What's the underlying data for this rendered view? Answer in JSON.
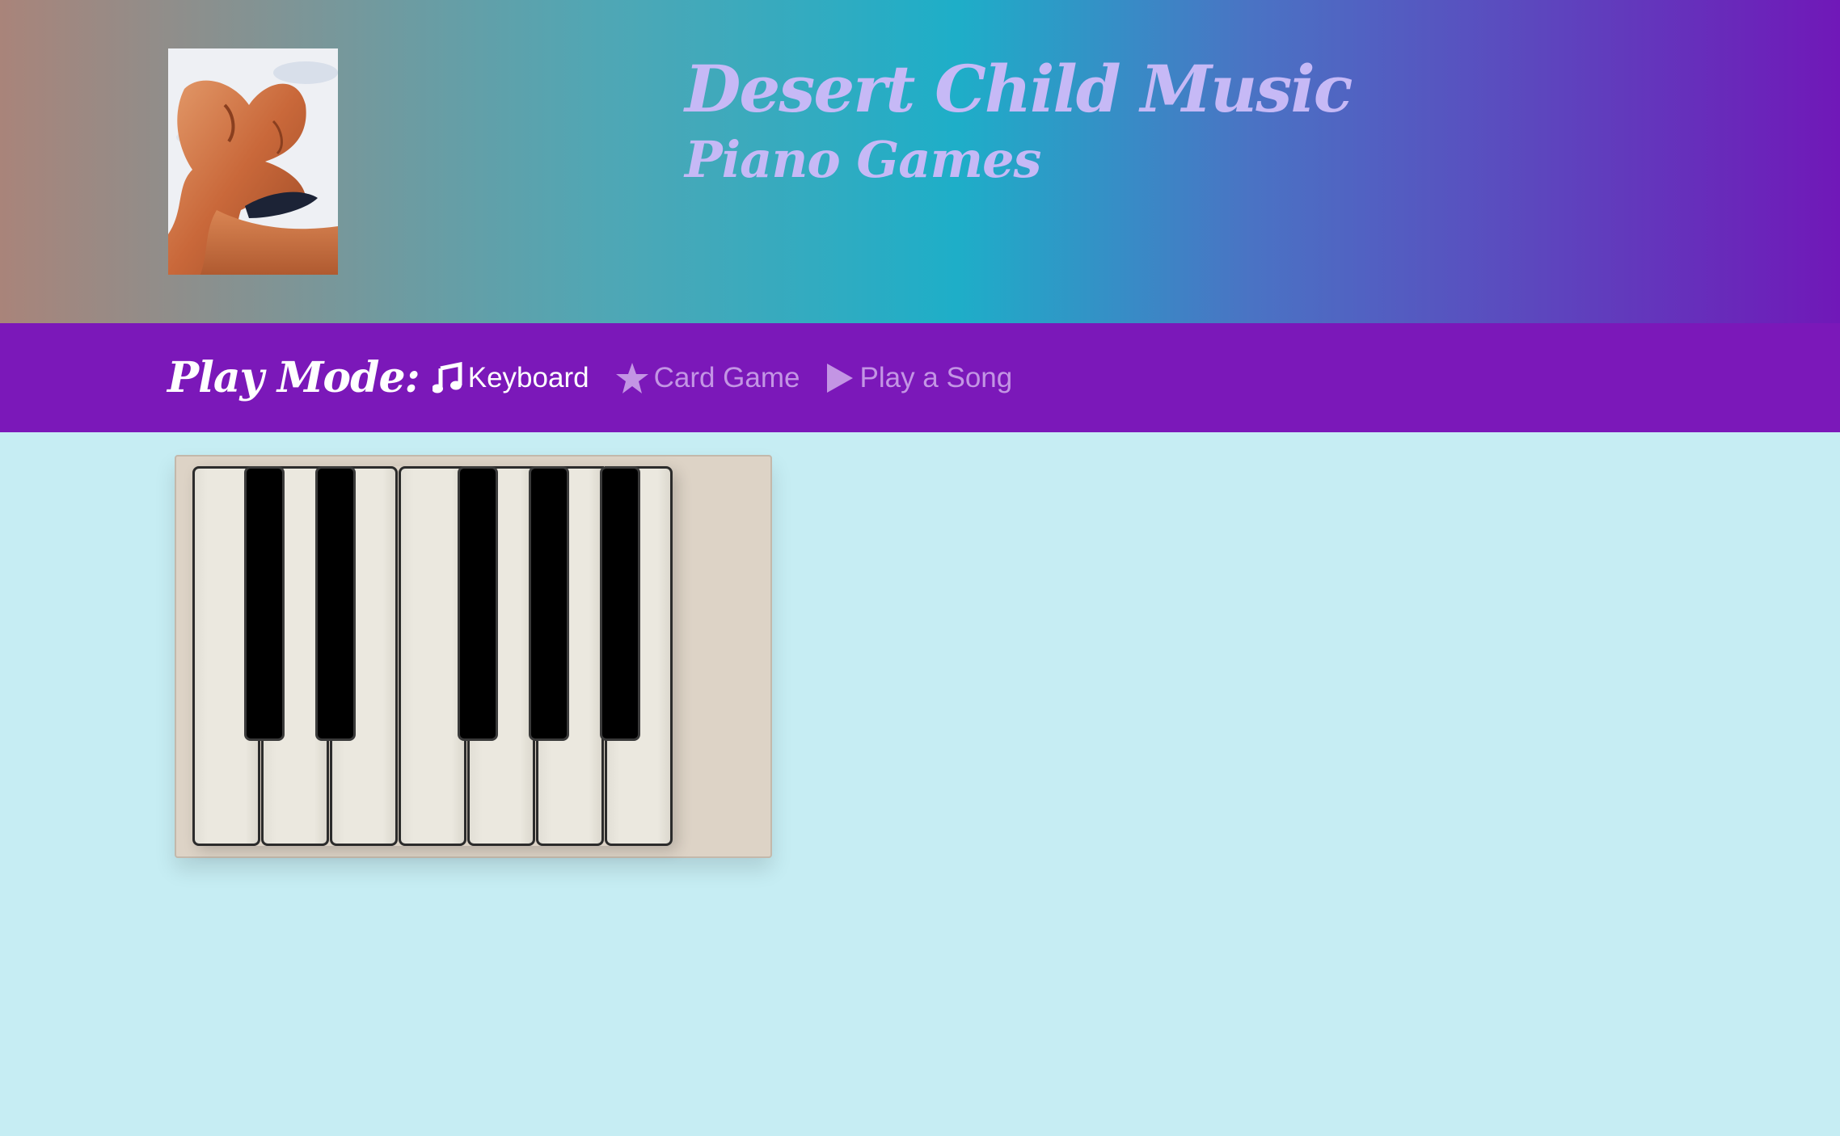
{
  "header": {
    "site_title": "Desert Child Music",
    "site_subtitle": "Piano Games",
    "logo_icon": "desert-rock-arch-photo"
  },
  "nav": {
    "label": "Play Mode:",
    "items": [
      {
        "label": "Keyboard",
        "icon": "music-note-icon",
        "active": true
      },
      {
        "label": "Card Game",
        "icon": "star-icon",
        "active": false
      },
      {
        "label": "Play a Song",
        "icon": "play-icon",
        "active": false
      }
    ]
  },
  "piano": {
    "white_keys": 7,
    "black_keys": 5
  },
  "colors": {
    "nav_background": "#7b18b9",
    "page_background": "#c6edf3",
    "title_color": "#c6b9f6",
    "inactive_nav": "#c395e4"
  }
}
